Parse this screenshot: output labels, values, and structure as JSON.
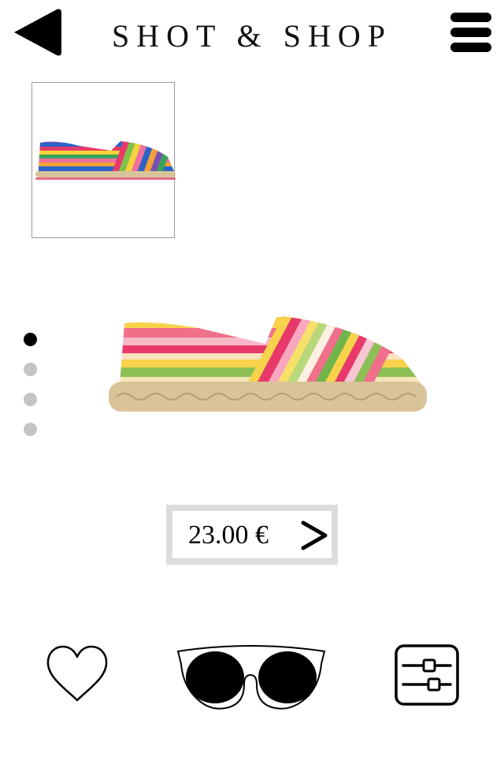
{
  "header": {
    "title": "SHOT & SHOP",
    "back_icon": "back-arrow-icon",
    "menu_icon": "hamburger-menu-icon"
  },
  "gallery": {
    "thumbnail_count": 1,
    "dot_count": 4,
    "active_dot": 1
  },
  "product": {
    "price": "23.00 €",
    "price_arrow_icon": "chevron-right-icon"
  },
  "actions": {
    "favorite_icon": "heart-icon",
    "try_on_icon": "sunglasses-icon",
    "filter_icon": "sliders-icon"
  },
  "colors": {
    "text": "#111111",
    "dot_active": "#000000",
    "dot_inactive": "#c4c4c4",
    "price_border": "#dcdcdc"
  }
}
